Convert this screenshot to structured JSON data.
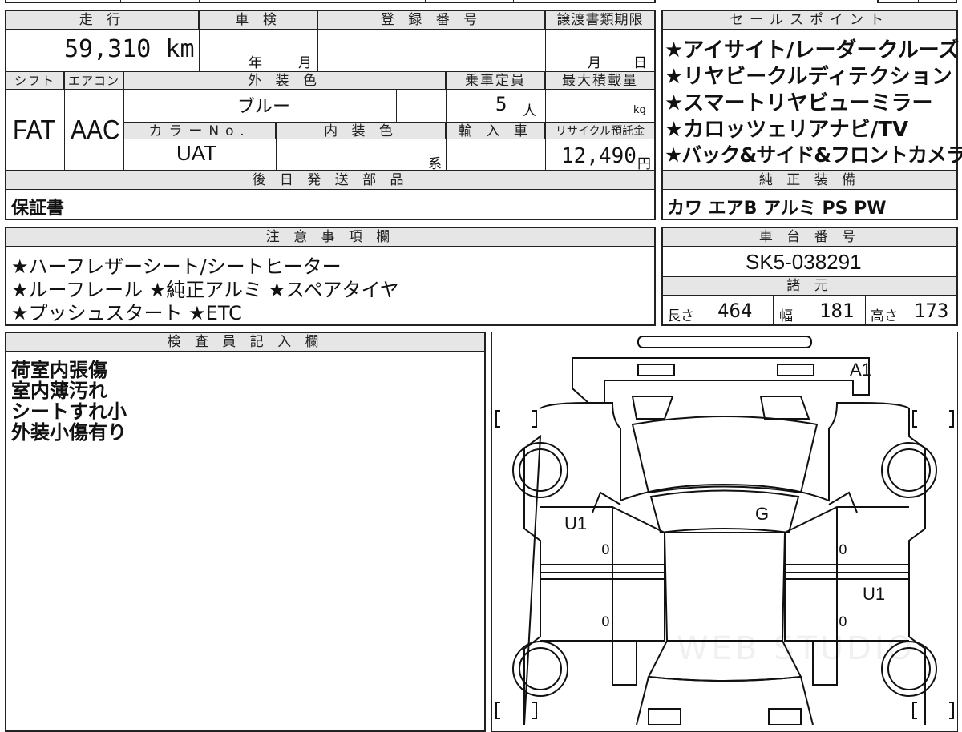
{
  "main_table": {
    "mileage_label": "走 行",
    "mileage_value": "59,310 km",
    "inspection_label": "車 検",
    "inspection_year": "年",
    "inspection_month": "月",
    "registration_label": "登 録 番 号",
    "transfer_label": "譲渡書類期限",
    "transfer_month": "月",
    "transfer_day": "日",
    "shift_label": "シフト",
    "shift_value": "FAT",
    "aircon_label": "エアコン",
    "aircon_value": "AAC",
    "exterior_label": "外 装 色",
    "exterior_value": "ブルー",
    "capacity_label": "乗車定員",
    "capacity_value": "5",
    "capacity_unit": "人",
    "maxload_label": "最大積載量",
    "maxload_unit": "kg",
    "color_no_label": "カラーNo.",
    "color_no_value": "UAT",
    "interior_label": "内 装 色",
    "interior_suffix": "系",
    "import_label": "輸 入 車",
    "recycle_label": "リサイクル預託金",
    "recycle_value": "12,490",
    "recycle_unit": "円"
  },
  "later_parts": {
    "label": "後 日 発 送 部 品",
    "value": "保証書"
  },
  "sales_points": {
    "label": "セールスポイント",
    "items": [
      "★アイサイト/レーダークルーズ",
      "★リヤビークルディテクション",
      "★スマートリヤビューミラー",
      "★カロッツェリアナビ/TV",
      "★バック&サイド&フロントカメラ"
    ]
  },
  "genuine_equipment": {
    "label": "純 正 装 備",
    "value": "カワ エアB アルミ PS PW"
  },
  "notes": {
    "label": "注 意 事 項 欄",
    "lines": [
      "★ハーフレザーシート/シートヒーター",
      "★ルーフレール ★純正アルミ ★スペアタイヤ",
      "★プッシュスタート ★ETC"
    ]
  },
  "chassis": {
    "label": "車 台 番 号",
    "value": "SK5-038291"
  },
  "specs": {
    "label": "諸 元",
    "length_label": "長さ",
    "length_value": "464",
    "width_label": "幅",
    "width_value": "181",
    "height_label": "高さ",
    "height_value": "173"
  },
  "inspector": {
    "label": "検 査 員 記 入 欄",
    "lines": [
      "荷室内張傷",
      "室内薄汚れ",
      "シートすれ小",
      "外装小傷有り"
    ]
  },
  "diagram": {
    "marks": {
      "a1": "A1",
      "u1_left": "U1",
      "g": "G",
      "u1_right": "U1",
      "zero_1": "0",
      "zero_2": "0",
      "zero_3": "0",
      "zero_4": "0"
    },
    "watermark": "WEB STUDIO"
  }
}
